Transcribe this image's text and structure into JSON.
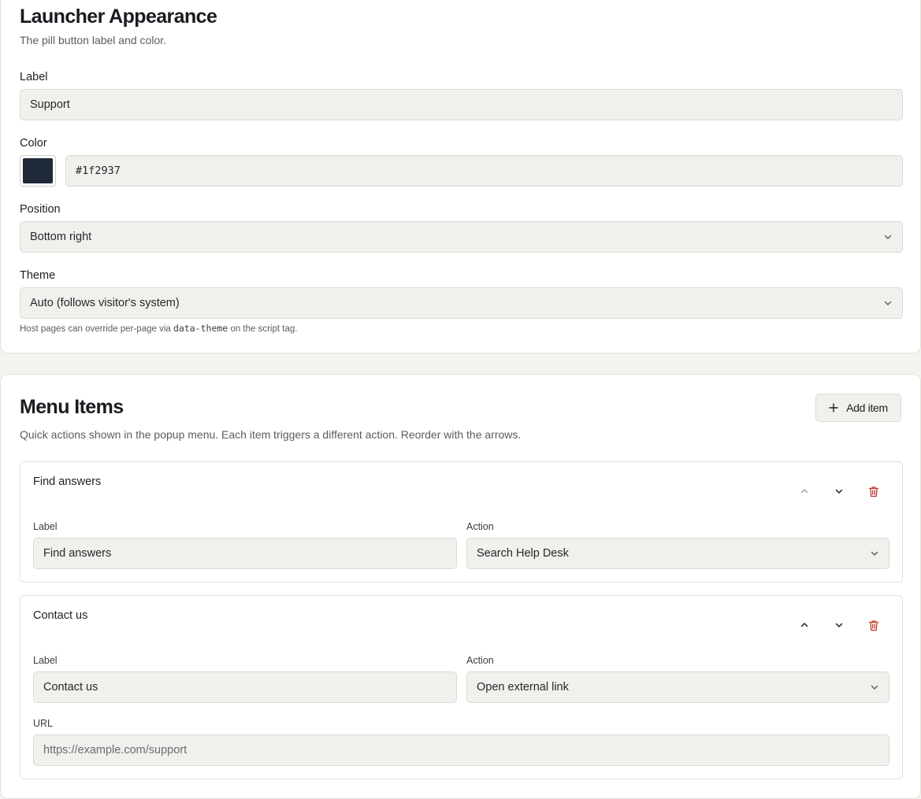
{
  "appearance": {
    "title": "Launcher Appearance",
    "subtitle": "The pill button label and color.",
    "label_field": {
      "label": "Label",
      "value": "Support"
    },
    "color_field": {
      "label": "Color",
      "value": "#1f2937",
      "swatch": "#1f2937"
    },
    "position_field": {
      "label": "Position",
      "value": "Bottom right"
    },
    "theme_field": {
      "label": "Theme",
      "value": "Auto (follows visitor's system)"
    },
    "hint": {
      "before": "Host pages can override per-page via",
      "code": "data-theme",
      "after": "on the script tag."
    }
  },
  "menu": {
    "title": "Menu Items",
    "subtitle": "Quick actions shown in the popup menu. Each item triggers a different action. Reorder with the arrows.",
    "add_button": "Add item",
    "items": [
      {
        "title": "Find answers",
        "label_caption": "Label",
        "label_value": "Find answers",
        "action_caption": "Action",
        "action_value": "Search Help Desk"
      },
      {
        "title": "Contact us",
        "label_caption": "Label",
        "label_value": "Contact us",
        "action_caption": "Action",
        "action_value": "Open external link",
        "url_caption": "URL",
        "url_value": "https://example.com/support"
      }
    ]
  },
  "icons": {
    "move_up": "chevron-up-icon",
    "move_down": "chevron-down-icon",
    "delete": "trash-icon",
    "add": "plus-icon",
    "select": "chevron-down-icon"
  },
  "colors": {
    "delete_icon": "#c0392b",
    "disabled_icon": "#9a9aa0",
    "icon": "#1f1f23"
  }
}
